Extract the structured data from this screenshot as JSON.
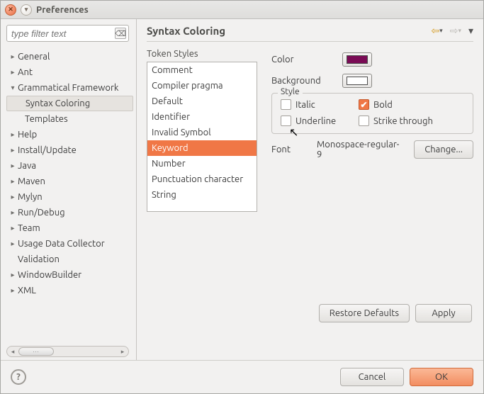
{
  "window": {
    "title": "Preferences"
  },
  "filter": {
    "placeholder": "type filter text"
  },
  "tree": {
    "items": [
      {
        "label": "General",
        "expandable": true,
        "expanded": false
      },
      {
        "label": "Ant",
        "expandable": true,
        "expanded": false
      },
      {
        "label": "Grammatical Framework",
        "expandable": true,
        "expanded": true
      },
      {
        "label": "Syntax Coloring",
        "child": true,
        "selected": true
      },
      {
        "label": "Templates",
        "child": true
      },
      {
        "label": "Help",
        "expandable": true,
        "expanded": false
      },
      {
        "label": "Install/Update",
        "expandable": true,
        "expanded": false
      },
      {
        "label": "Java",
        "expandable": true,
        "expanded": false
      },
      {
        "label": "Maven",
        "expandable": true,
        "expanded": false
      },
      {
        "label": "Mylyn",
        "expandable": true,
        "expanded": false
      },
      {
        "label": "Run/Debug",
        "expandable": true,
        "expanded": false
      },
      {
        "label": "Team",
        "expandable": true,
        "expanded": false
      },
      {
        "label": "Usage Data Collector",
        "expandable": true,
        "expanded": false
      },
      {
        "label": "Validation",
        "expandable": false
      },
      {
        "label": "WindowBuilder",
        "expandable": true,
        "expanded": false
      },
      {
        "label": "XML",
        "expandable": true,
        "expanded": false
      }
    ]
  },
  "page": {
    "title": "Syntax Coloring",
    "token_styles_label": "Token Styles",
    "tokens": [
      "Comment",
      "Compiler pragma",
      "Default",
      "Identifier",
      "Invalid Symbol",
      "Keyword",
      "Number",
      "Punctuation character",
      "String"
    ],
    "selected_token_index": 5,
    "color_label": "Color",
    "color_value": "#7a0b55",
    "background_label": "Background",
    "background_value": "#ffffff",
    "style_label": "Style",
    "italic_label": "Italic",
    "italic_checked": false,
    "bold_label": "Bold",
    "bold_checked": true,
    "underline_label": "Underline",
    "underline_checked": false,
    "strike_label": "Strike through",
    "strike_checked": false,
    "font_label": "Font",
    "font_value": "Monospace-regular-9",
    "change_label": "Change..."
  },
  "buttons": {
    "restore": "Restore Defaults",
    "apply": "Apply",
    "cancel": "Cancel",
    "ok": "OK"
  }
}
